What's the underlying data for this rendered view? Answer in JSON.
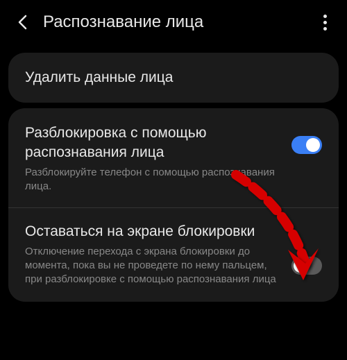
{
  "header": {
    "title": "Распознавание лица"
  },
  "delete_card": {
    "label": "Удалить данные лица"
  },
  "setting1": {
    "title": "Разблокировка с помощью распознавания лица",
    "desc": "Разблокируйте телефон с помощью распознавания лица.",
    "enabled": true
  },
  "setting2": {
    "title": "Оставаться на экране блокировки",
    "desc": "Отключение перехода с экрана блокировки до момента, пока вы не проведете по нему пальцем, при разблокировке с помощью распознавания лица",
    "enabled": false
  },
  "colors": {
    "accent": "#3a7ff5",
    "annotation": "#d60000"
  }
}
